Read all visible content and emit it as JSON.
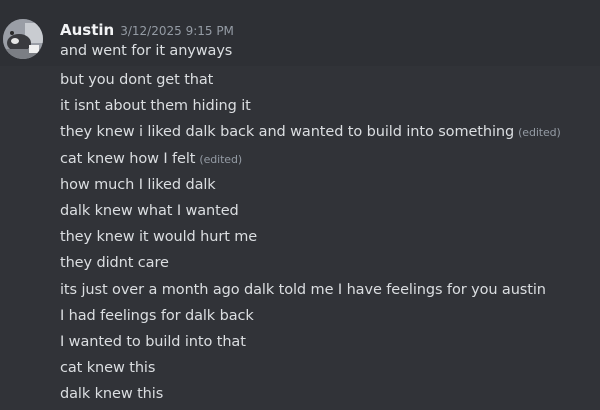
{
  "message": {
    "author": "Austin",
    "timestamp": "3/12/2025 9:15 PM",
    "edited_label": "(edited)",
    "lines": [
      {
        "text": "and went for it anyways",
        "edited": false
      },
      {
        "text": "but you dont get that",
        "edited": false
      },
      {
        "text": "it isnt about them hiding it",
        "edited": false
      },
      {
        "text": "they knew i liked dalk back and wanted to build into something",
        "edited": true
      },
      {
        "text": "cat knew how I felt",
        "edited": true
      },
      {
        "text": "how much I liked dalk",
        "edited": false
      },
      {
        "text": "dalk knew what I wanted",
        "edited": false
      },
      {
        "text": "they knew it would hurt me",
        "edited": false
      },
      {
        "text": "they didnt care",
        "edited": false
      },
      {
        "text": "its just over a month ago dalk told me I have feelings for you austin",
        "edited": false
      },
      {
        "text": "I had feelings for dalk back",
        "edited": false
      },
      {
        "text": "I wanted to build into that",
        "edited": false
      },
      {
        "text": "cat knew this",
        "edited": false
      },
      {
        "text": "dalk knew this",
        "edited": false
      }
    ]
  }
}
